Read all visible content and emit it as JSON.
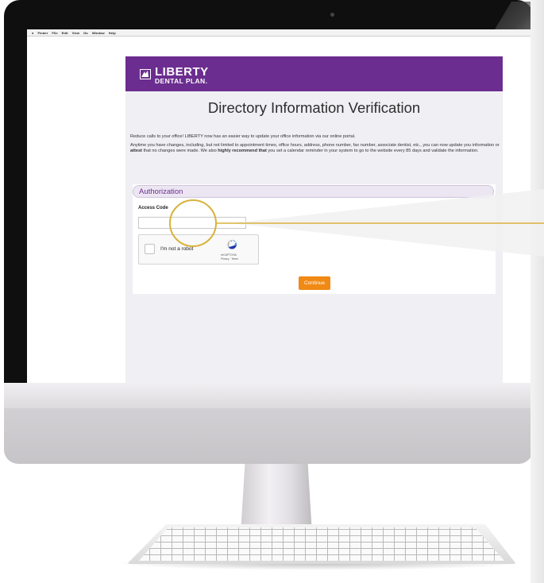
{
  "menu_bar": {
    "items": [
      "Finder",
      "File",
      "Edit",
      "View",
      "Go",
      "Window",
      "Help"
    ]
  },
  "header": {
    "logo_main": "LIBERTY",
    "logo_sub": "DENTAL PLAN."
  },
  "page_title": "Directory Information Verification",
  "intro": {
    "p1": "Reduce calls to your office! LIBERTY now has an easier way to update your office information via our online portal.",
    "p2_a": "Anytime you have changes, including, but not limited to appointment times, office hours, address, phone number, fax number, associate dentist, etc., you can now update you information or ",
    "p2_b": "attest",
    "p2_c": " that no changes were made. We also ",
    "p2_d": "highly recommend that",
    "p2_e": " you set a calendar reminder in your system to go to the website every 85 days and validate the information."
  },
  "authorization": {
    "heading": "Authorization",
    "access_code_label": "Access Code",
    "access_code_value": ""
  },
  "recaptcha": {
    "label": "I'm not a robot",
    "brand": "reCAPTCHA",
    "links": "Privacy - Terms"
  },
  "buttons": {
    "continue": "Continue"
  },
  "colors": {
    "brand_purple": "#6b2d8f",
    "continue_orange": "#f08a14",
    "callout_gold": "#d8b23c"
  }
}
